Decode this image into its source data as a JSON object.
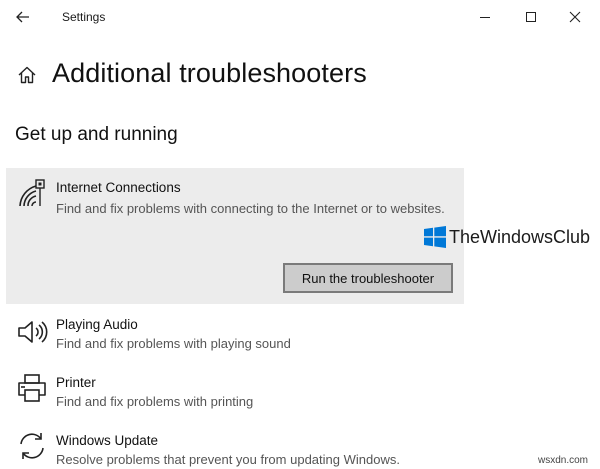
{
  "window": {
    "title": "Settings"
  },
  "page": {
    "title": "Additional troubleshooters",
    "section": "Get up and running"
  },
  "items": [
    {
      "name": "Internet Connections",
      "description": "Find and fix problems with connecting to the Internet or to websites.",
      "icon": "wifi-icon",
      "selected": true
    },
    {
      "name": "Playing Audio",
      "description": "Find and fix problems with playing sound",
      "icon": "speaker-icon",
      "selected": false
    },
    {
      "name": "Printer",
      "description": "Find and fix problems with printing",
      "icon": "printer-icon",
      "selected": false
    },
    {
      "name": "Windows Update",
      "description": "Resolve problems that prevent you from updating Windows.",
      "icon": "refresh-icon",
      "selected": false
    }
  ],
  "run_button_label": "Run the troubleshooter",
  "watermark": "TheWindowsClub",
  "credit": "wsxdn.com",
  "colors": {
    "selected_bg": "#ececec",
    "button_bg": "#cccccc",
    "logo_blue": "#0078d7"
  }
}
